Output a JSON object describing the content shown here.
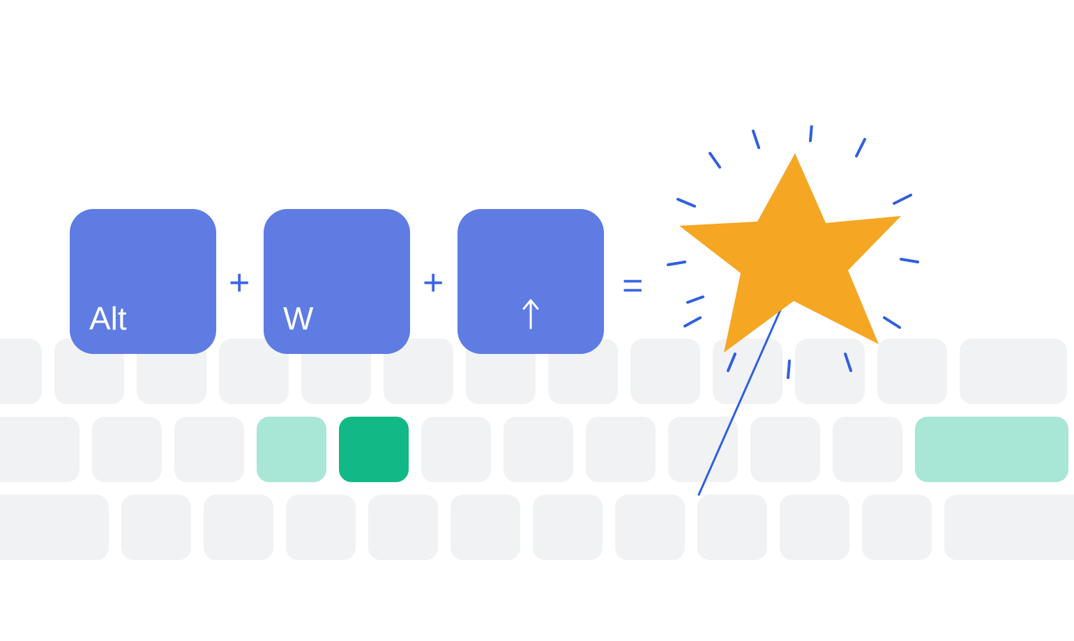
{
  "shortcut": {
    "keys": [
      "Alt",
      "W",
      "↑"
    ],
    "operators": [
      "+",
      "+",
      "="
    ]
  },
  "colors": {
    "key_blue": "#5e7ce2",
    "operator_blue": "#3a66e6",
    "bg_key_grey": "#f1f2f4",
    "mint": "#a8e6d5",
    "teal": "#12b886",
    "star_orange": "#f5a623",
    "sparkle_blue": "#2f5fe0",
    "wand_blue": "#2f5fe0"
  },
  "keyboard": {
    "row1": [
      {
        "type": "normal"
      },
      {
        "type": "normal"
      },
      {
        "type": "normal"
      },
      {
        "type": "normal"
      },
      {
        "type": "normal"
      },
      {
        "type": "normal"
      },
      {
        "type": "normal"
      },
      {
        "type": "normal"
      },
      {
        "type": "normal"
      },
      {
        "type": "normal"
      },
      {
        "type": "normal"
      },
      {
        "type": "normal"
      },
      {
        "type": "normal"
      },
      {
        "type": "wide1"
      }
    ],
    "row2": [
      {
        "type": "wide1"
      },
      {
        "type": "normal"
      },
      {
        "type": "normal"
      },
      {
        "type": "mint"
      },
      {
        "type": "teal"
      },
      {
        "type": "normal"
      },
      {
        "type": "normal"
      },
      {
        "type": "normal"
      },
      {
        "type": "normal"
      },
      {
        "type": "normal"
      },
      {
        "type": "normal"
      },
      {
        "type": "mint-wide"
      }
    ],
    "row3": [
      {
        "type": "wide2"
      },
      {
        "type": "normal"
      },
      {
        "type": "normal"
      },
      {
        "type": "normal"
      },
      {
        "type": "normal"
      },
      {
        "type": "normal"
      },
      {
        "type": "normal"
      },
      {
        "type": "normal"
      },
      {
        "type": "normal"
      },
      {
        "type": "normal"
      },
      {
        "type": "normal"
      },
      {
        "type": "wide3"
      }
    ]
  }
}
